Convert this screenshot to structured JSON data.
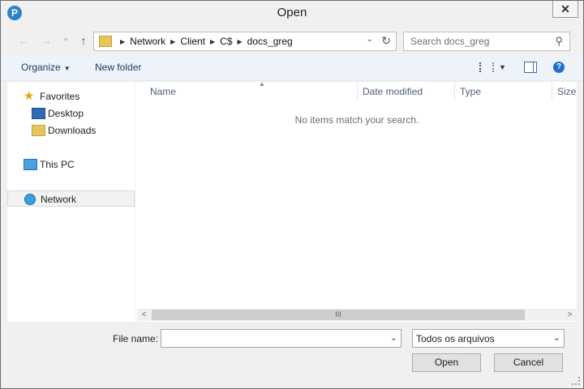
{
  "window": {
    "title": "Open",
    "close_label": "✕"
  },
  "nav": {
    "back_icon": "←",
    "forward_icon": "→",
    "recent_icon": "▾",
    "up_icon": "↑",
    "breadcrumbs": [
      "Network",
      "Client",
      "C$",
      "docs_greg"
    ],
    "dropdown_icon": "⌄",
    "refresh_icon": "↻"
  },
  "search": {
    "placeholder": "Search docs_greg",
    "value": ""
  },
  "toolbar": {
    "organize": "Organize",
    "new_folder": "New folder",
    "help_icon": "?"
  },
  "sidebar": {
    "favorites": "Favorites",
    "desktop": "Desktop",
    "downloads": "Downloads",
    "this_pc": "This PC",
    "network": "Network"
  },
  "columns": [
    "Name",
    "Date modified",
    "Type",
    "Size"
  ],
  "main": {
    "empty_message": "No items match your search."
  },
  "scroll": {
    "left": "<",
    "right": ">",
    "thumb": "III"
  },
  "footer": {
    "file_name_label": "File name:",
    "file_name_value": "",
    "file_type": "Todos os arquivos",
    "open_button": "Open",
    "cancel_button": "Cancel"
  }
}
